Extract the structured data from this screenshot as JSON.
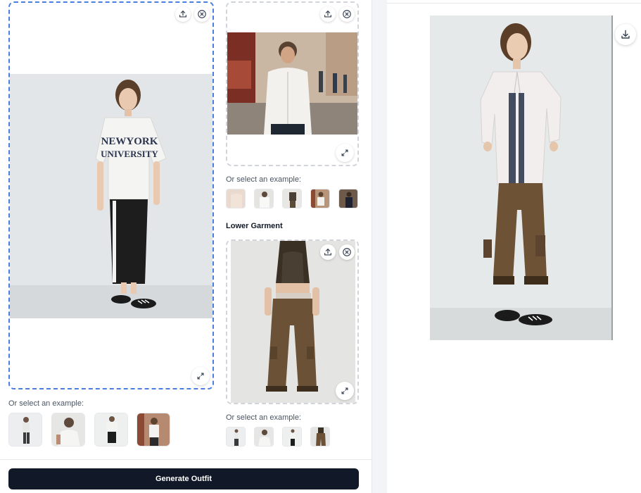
{
  "model_panel": {
    "example_label": "Or select an example:",
    "examples": [
      "model-example-1",
      "model-example-2",
      "model-example-3",
      "model-example-4"
    ]
  },
  "upper_panel": {
    "example_label": "Or select an example:",
    "examples": [
      "upper-example-1",
      "upper-example-2",
      "upper-example-3",
      "upper-example-4",
      "upper-example-5"
    ]
  },
  "lower_panel": {
    "title": "Lower Garment",
    "example_label": "Or select an example:",
    "examples": [
      "lower-example-1",
      "lower-example-2",
      "lower-example-3",
      "lower-example-4"
    ]
  },
  "model_image_text": {
    "line1": "NEWYORK",
    "line2": "UNIVERSITY"
  },
  "actions": {
    "generate_label": "Generate Outfit"
  },
  "icons": {
    "upload": "upload-icon",
    "clear": "close-circle-icon",
    "expand": "expand-icon",
    "download": "download-icon"
  },
  "colors": {
    "accent_dashed": "#4a7fe0",
    "button_bg": "#111827"
  }
}
